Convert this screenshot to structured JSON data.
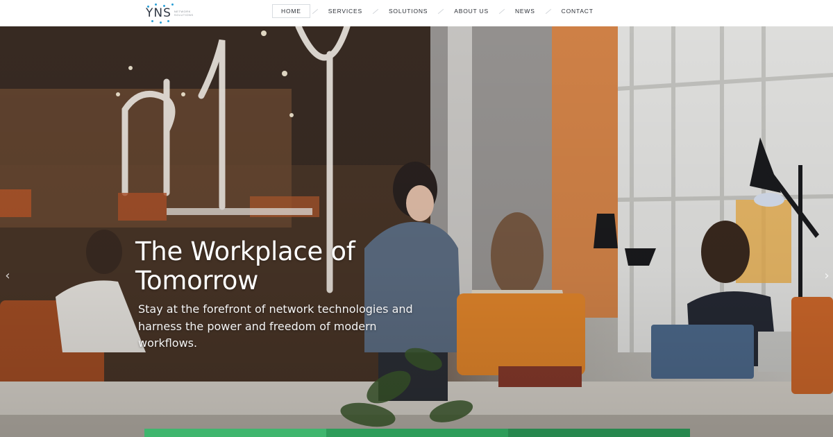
{
  "logo": {
    "mark": "YNS",
    "subtitle_line1": "NETWORK",
    "subtitle_line2": "SOLUTIONS",
    "accent": "#2a9fd6"
  },
  "nav": {
    "items": [
      {
        "label": "HOME",
        "active": true
      },
      {
        "label": "SERVICES",
        "active": false
      },
      {
        "label": "SOLUTIONS",
        "active": false
      },
      {
        "label": "ABOUT US",
        "active": false
      },
      {
        "label": "NEWS",
        "active": false
      },
      {
        "label": "CONTACT",
        "active": false
      }
    ]
  },
  "hero": {
    "title_line1": "The Workplace of",
    "title_line2": "Tomorrow",
    "subtitle": "Stay at the forefront of network technologies and harness the power and freedom of modern workflows.",
    "prev_arrow": "‹",
    "next_arrow": "›"
  },
  "bottom_bar": {
    "colors": [
      "#3fb66e",
      "#2e9d5a",
      "#27884e"
    ]
  },
  "icons": {
    "prev": "chevron-left-icon",
    "next": "chevron-right-icon"
  }
}
